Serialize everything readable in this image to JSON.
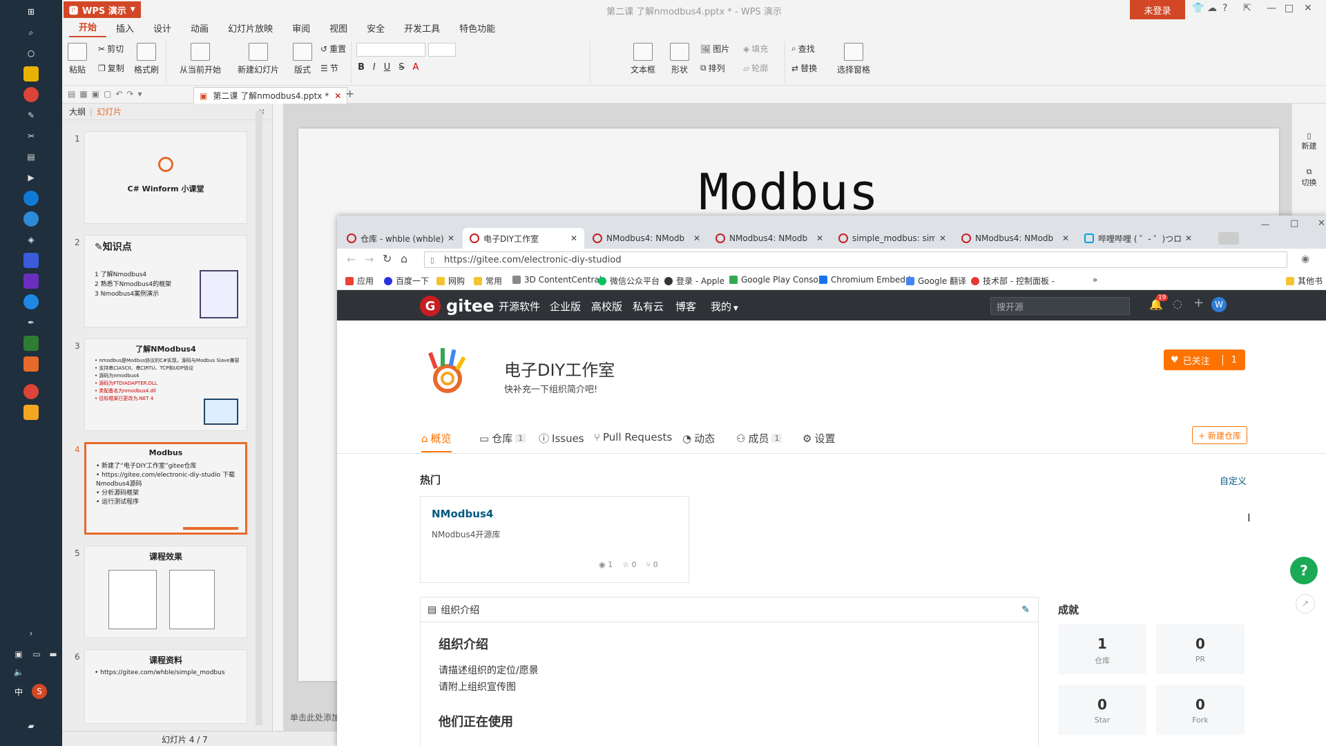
{
  "wps": {
    "app_name": "WPS 演示",
    "doc_title": "第二课 了解nmodbus4.pptx * - WPS 演示",
    "login": "未登录",
    "ribbon_tabs": [
      "开始",
      "插入",
      "设计",
      "动画",
      "幻灯片放映",
      "审阅",
      "视图",
      "安全",
      "开发工具",
      "特色功能"
    ],
    "ribbon": {
      "paste": "粘贴",
      "cut": "剪切",
      "copy": "复制",
      "format_painter": "格式刷",
      "from_start": "从当前开始",
      "new_slide": "新建幻灯片",
      "layout": "版式",
      "reset": "重置",
      "section": "节",
      "textbox": "文本框",
      "shape": "形状",
      "arrange": "排列",
      "picture": "图片",
      "fill": "填充",
      "outline": "轮廓",
      "find": "查找",
      "replace": "替换",
      "select_pane": "选择窗格"
    },
    "doc_tab": "第二课 了解nmodbus4.pptx *",
    "panel": {
      "outline": "大纲",
      "slides": "幻灯片"
    },
    "thumbs": [
      {
        "num": "1",
        "title": "C# Winform 小课堂",
        "lines": []
      },
      {
        "num": "2",
        "title": "✎知识点",
        "lines": [
          "1  了解Nmodbus4",
          "2  熟悉下Nmodbus4的框架",
          "3  Nmodbus4案例演示"
        ]
      },
      {
        "num": "3",
        "title": "了解NModbus4",
        "lines": [
          "• nmodbus是Modbus协议的C#实现，源码与Modbus Slave兼容",
          "• 支持串口ASCII、串口RTU、TCP和UDP协议",
          "• 源码为nmodbus4",
          "• 源码为FTDIADAPTER.DLL",
          "• 类配备名为nmodbus4.dll",
          "• 目标框架已更改为.NET 4"
        ]
      },
      {
        "num": "4",
        "title": "Modbus",
        "lines": [
          "• 新建了“电子DIY工作室”gitee仓库",
          "• https://gitee.com/electronic-diy-studio  下载Nmodbus4源码",
          "• 分析源码框架",
          "• 运行测试程序"
        ]
      },
      {
        "num": "5",
        "title": "课程效果",
        "lines": []
      },
      {
        "num": "6",
        "title": "课程资料",
        "lines": [
          "• https://gitee.com/whble/simple_modbus"
        ]
      }
    ],
    "slide_title": "Modbus",
    "notes_hint": "单击此处添加",
    "right_tools": {
      "new": "新建",
      "switch": "切换"
    },
    "status": "幻灯片 4 / 7"
  },
  "browser": {
    "tabs": [
      {
        "label": "仓库 - whble (whble)"
      },
      {
        "label": "电子DIY工作室"
      },
      {
        "label": "NModbus4: NModb"
      },
      {
        "label": "NModbus4: NModb"
      },
      {
        "label": "simple_modbus: sim"
      },
      {
        "label": "NModbus4: NModb"
      },
      {
        "label": "哔哩哔哩 ( ゜- ゜)つロ"
      }
    ],
    "url": "https://gitee.com/electronic-diy-studiod",
    "bookmarks": [
      "应用",
      "百度一下",
      "网购",
      "常用",
      "3D ContentCentral",
      "微信公众平台",
      "登录 - Apple",
      "Google Play Consol",
      "Chromium Embedd",
      "Google 翻译",
      "技术部 - 控制面板 -",
      "其他书"
    ],
    "bookmarks_more": "»"
  },
  "gitee": {
    "logo": "gitee",
    "nav": [
      "开源软件",
      "企业版",
      "高校版",
      "私有云",
      "博客",
      "我的"
    ],
    "search_placeholder": "搜开源",
    "notif_count": "19",
    "avatar": "W",
    "org_name": "电子DIY工作室",
    "org_desc": "快补充一下组织简介吧!",
    "follow": "已关注",
    "follow_count": "1",
    "tabs": [
      {
        "label": "概览"
      },
      {
        "label": "仓库",
        "badge": "1"
      },
      {
        "label": "Issues"
      },
      {
        "label": "Pull Requests"
      },
      {
        "label": "动态"
      },
      {
        "label": "成员",
        "badge": "1"
      },
      {
        "label": "设置"
      }
    ],
    "new_repo": "+ 新建仓库",
    "hot": "热门",
    "customize": "自定义",
    "repo": {
      "name": "NModbus4",
      "desc": "NModbus4开源库",
      "watch": "1",
      "star": "0",
      "fork": "0"
    },
    "intro_header": "组织介绍",
    "intro_title": "组织介绍",
    "intro_lines": [
      "请描述组织的定位/愿景",
      "请附上组织宣传图"
    ],
    "using_title": "他们正在使用",
    "achievements": "成就",
    "stats": [
      {
        "value": "1",
        "label": "仓库"
      },
      {
        "value": "0",
        "label": "PR"
      },
      {
        "value": "0",
        "label": "Star"
      },
      {
        "value": "0",
        "label": "Fork"
      }
    ],
    "help": "?"
  }
}
